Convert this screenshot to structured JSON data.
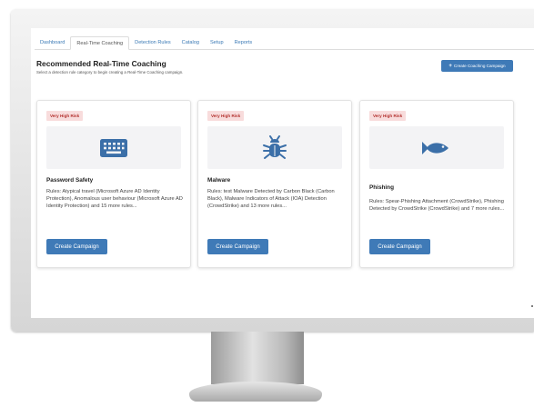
{
  "nav": {
    "tabs": [
      {
        "label": "Dashboard",
        "active": false
      },
      {
        "label": "Real-Time Coaching",
        "active": true
      },
      {
        "label": "Detection Rules",
        "active": false
      },
      {
        "label": "Catalog",
        "active": false
      },
      {
        "label": "Setup",
        "active": false
      },
      {
        "label": "Reports",
        "active": false
      }
    ]
  },
  "header": {
    "title": "Recommended Real-Time Coaching",
    "subtitle": "Select a detection rule category to begin creating a Real-Time Coaching campaign.",
    "create_button": "Create Coaching Campaign",
    "create_icon": "plus-icon"
  },
  "cards": [
    {
      "risk": "Very High Risk",
      "icon": "keyboard-icon",
      "title": "Password Safety",
      "rules": "Rules: Atypical travel (Microsoft Azure AD Identity Protection), Anomalous user behaviour (Microsoft Azure AD Identity Protection) and 15 more rules...",
      "button": "Create Campaign"
    },
    {
      "risk": "Very High Risk",
      "icon": "bug-icon",
      "title": "Malware",
      "rules": "Rules: test Malware Detected by Carbon Black (Carbon Black), Malware Indicators of Attack (IOA) Detection (CrowdStrike) and 13 more rules...",
      "button": "Create Campaign"
    },
    {
      "risk": "Very High Risk",
      "icon": "fish-icon",
      "title": "Phishing",
      "rules": "Rules: Spear-Phishing Attachment (CrowdStrike), Phishing Detected by CrowdStrike (CrowdStrike) and 7 more rules...",
      "button": "Create Campaign"
    }
  ],
  "colors": {
    "primary": "#3f7ab7",
    "risk_bg": "#f8dcdc",
    "risk_text": "#b3312e",
    "icon": "#3b6fa8"
  }
}
